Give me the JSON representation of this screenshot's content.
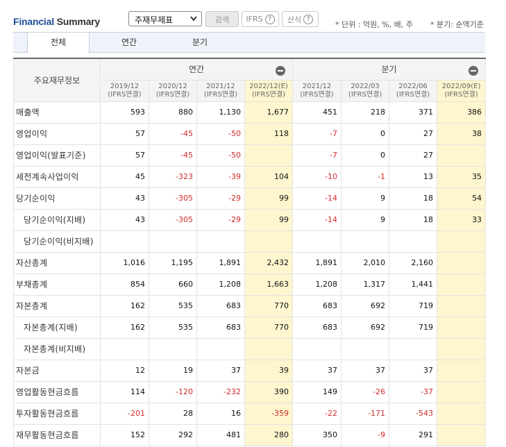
{
  "header": {
    "title_a": "Financial",
    "title_b": " Summary",
    "select_value": "주재무제표",
    "search_label": "검색",
    "ifrs_label": "IFRS",
    "sansik_label": "산식",
    "help_glyph": "?",
    "unit_note": "* 단위 : 억원, %, 배, 주",
    "basis_note": "* 분기: 순액기준"
  },
  "tabs": [
    "전체",
    "연간",
    "분기"
  ],
  "table": {
    "corner_label": "주요재무정보",
    "group_annual": "연간",
    "group_quarter": "분기",
    "periods": [
      {
        "date": "2019/12",
        "basis": "(IFRS연결)"
      },
      {
        "date": "2020/12",
        "basis": "(IFRS연결)"
      },
      {
        "date": "2021/12",
        "basis": "(IFRS연결)"
      },
      {
        "date": "2022/12(E)",
        "basis": "(IFRS연결)"
      },
      {
        "date": "2021/12",
        "basis": "(IFRS연결)"
      },
      {
        "date": "2022/03",
        "basis": "(IFRS연결)"
      },
      {
        "date": "2022/06",
        "basis": "(IFRS연결)"
      },
      {
        "date": "2022/09(E)",
        "basis": "(IFRS연결)"
      }
    ],
    "rows": [
      {
        "label": "매출액",
        "values": [
          "593",
          "880",
          "1,130",
          "1,677",
          "451",
          "218",
          "371",
          "386"
        ]
      },
      {
        "label": "영업이익",
        "values": [
          "57",
          "-45",
          "-50",
          "118",
          "-7",
          "0",
          "27",
          "38"
        ]
      },
      {
        "label": "영업이익(발표기준)",
        "values": [
          "57",
          "-45",
          "-50",
          "",
          "-7",
          "0",
          "27",
          ""
        ]
      },
      {
        "label": "세전계속사업이익",
        "values": [
          "45",
          "-323",
          "-39",
          "104",
          "-10",
          "-1",
          "13",
          "35"
        ]
      },
      {
        "label": "당기순이익",
        "values": [
          "43",
          "-305",
          "-29",
          "99",
          "-14",
          "9",
          "18",
          "54"
        ]
      },
      {
        "label": "당기순이익(지배)",
        "values": [
          "43",
          "-305",
          "-29",
          "99",
          "-14",
          "9",
          "18",
          "33"
        ]
      },
      {
        "label": "당기순이익(비지배)",
        "values": [
          "",
          "",
          "",
          "",
          "",
          "",
          "",
          ""
        ]
      },
      {
        "label": "자산총계",
        "values": [
          "1,016",
          "1,195",
          "1,891",
          "2,432",
          "1,891",
          "2,010",
          "2,160",
          ""
        ]
      },
      {
        "label": "부채총계",
        "values": [
          "854",
          "660",
          "1,208",
          "1,663",
          "1,208",
          "1,317",
          "1,441",
          ""
        ]
      },
      {
        "label": "자본총계",
        "values": [
          "162",
          "535",
          "683",
          "770",
          "683",
          "692",
          "719",
          ""
        ]
      },
      {
        "label": "자본총계(지배)",
        "values": [
          "162",
          "535",
          "683",
          "770",
          "683",
          "692",
          "719",
          ""
        ]
      },
      {
        "label": "자본총계(비지배)",
        "values": [
          "",
          "",
          "",
          "",
          "",
          "",
          "",
          ""
        ]
      },
      {
        "label": "자본금",
        "values": [
          "12",
          "19",
          "37",
          "39",
          "37",
          "37",
          "37",
          ""
        ]
      },
      {
        "label": "영업활동현금흐름",
        "values": [
          "114",
          "-120",
          "-232",
          "390",
          "149",
          "-26",
          "-37",
          ""
        ]
      },
      {
        "label": "투자활동현금흐름",
        "values": [
          "-201",
          "28",
          "16",
          "-359",
          "-22",
          "-171",
          "-543",
          ""
        ]
      },
      {
        "label": "재무활동현금흐름",
        "values": [
          "152",
          "292",
          "481",
          "280",
          "350",
          "-9",
          "291",
          ""
        ]
      }
    ],
    "sub_rows": [
      5,
      6,
      10,
      11
    ],
    "estimate_columns": [
      3,
      7
    ]
  },
  "colors": {
    "title_blue": "#1e4c9a",
    "estimate_bg": "#fdf6cf",
    "negative": "#d12a2a"
  }
}
